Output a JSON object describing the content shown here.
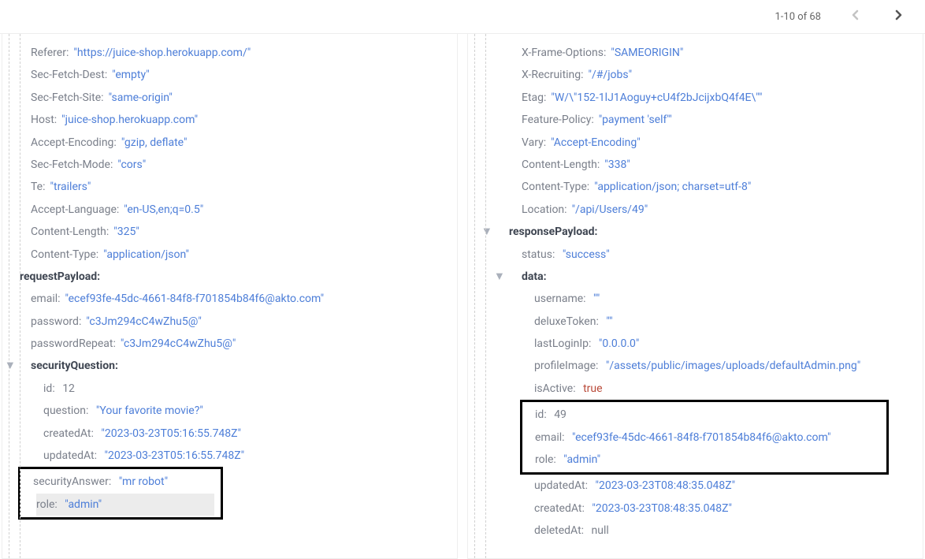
{
  "pagination": {
    "label": "1-10 of 68"
  },
  "left": {
    "headers": [
      {
        "k": "Referer",
        "v": "\"https://juice-shop.herokuapp.com/\""
      },
      {
        "k": "Sec-Fetch-Dest",
        "v": "\"empty\""
      },
      {
        "k": "Sec-Fetch-Site",
        "v": "\"same-origin\""
      },
      {
        "k": "Host",
        "v": "\"juice-shop.herokuapp.com\""
      },
      {
        "k": "Accept-Encoding",
        "v": "\"gzip, deflate\""
      },
      {
        "k": "Sec-Fetch-Mode",
        "v": "\"cors\""
      },
      {
        "k": "Te",
        "v": "\"trailers\""
      },
      {
        "k": "Accept-Language",
        "v": "\"en-US,en;q=0.5\""
      },
      {
        "k": "Content-Length",
        "v": "\"325\""
      },
      {
        "k": "Content-Type",
        "v": "\"application/json\""
      }
    ],
    "requestPayloadLabel": "requestPayload",
    "payload": [
      {
        "k": "email",
        "v": "\"ecef93fe-45dc-4661-84f8-f701854b84f6@akto.com\""
      },
      {
        "k": "password",
        "v": "\"c3Jm294cC4wZhu5@\""
      },
      {
        "k": "passwordRepeat",
        "v": "\"c3Jm294cC4wZhu5@\""
      }
    ],
    "securityQuestionLabel": "securityQuestion",
    "sq": {
      "idKey": "id",
      "idVal": "12",
      "qKey": "question",
      "qVal": "\"Your favorite movie?\"",
      "cKey": "createdAt",
      "cVal": "\"2023-03-23T05:16:55.748Z\"",
      "uKey": "updatedAt",
      "uVal": "\"2023-03-23T05:16:55.748Z\""
    },
    "boxed": {
      "saKey": "securityAnswer",
      "saVal": "\"mr robot\"",
      "roleKey": "role",
      "roleVal": "\"admin\""
    }
  },
  "right": {
    "headers": [
      {
        "k": "X-Frame-Options",
        "v": "\"SAMEORIGIN\""
      },
      {
        "k": "X-Recruiting",
        "v": "\"/#/jobs\""
      },
      {
        "k": "Etag",
        "v": "\"W/\\\"152-1lJ1Aoguy+cU4f2bJcijxbQ4f4E\\\"\""
      },
      {
        "k": "Feature-Policy",
        "v": "\"payment 'self'\""
      },
      {
        "k": "Vary",
        "v": "\"Accept-Encoding\""
      },
      {
        "k": "Content-Length",
        "v": "\"338\""
      },
      {
        "k": "Content-Type",
        "v": "\"application/json; charset=utf-8\""
      },
      {
        "k": "Location",
        "v": "\"/api/Users/49\""
      }
    ],
    "responsePayloadLabel": "responsePayload",
    "statusKey": "status",
    "statusVal": "\"success\"",
    "dataLabel": "data",
    "data": {
      "usernameKey": "username",
      "usernameVal": "\"\"",
      "deluxeTokenKey": "deluxeToken",
      "deluxeTokenVal": "\"\"",
      "lastLoginIpKey": "lastLoginIp",
      "lastLoginIpVal": "\"0.0.0.0\"",
      "profileImageKey": "profileImage",
      "profileImageVal": "\"/assets/public/images/uploads/defaultAdmin.png\"",
      "isActiveKey": "isActive",
      "isActiveVal": "true"
    },
    "boxed": {
      "idKey": "id",
      "idVal": "49",
      "emailKey": "email",
      "emailVal": "\"ecef93fe-45dc-4661-84f8-f701854b84f6@akto.com\"",
      "roleKey": "role",
      "roleVal": "\"admin\""
    },
    "tail": {
      "updatedAtKey": "updatedAt",
      "updatedAtVal": "\"2023-03-23T08:48:35.048Z\"",
      "createdAtKey": "createdAt",
      "createdAtVal": "\"2023-03-23T08:48:35.048Z\"",
      "deletedAtKey": "deletedAt",
      "deletedAtVal": "null"
    }
  }
}
